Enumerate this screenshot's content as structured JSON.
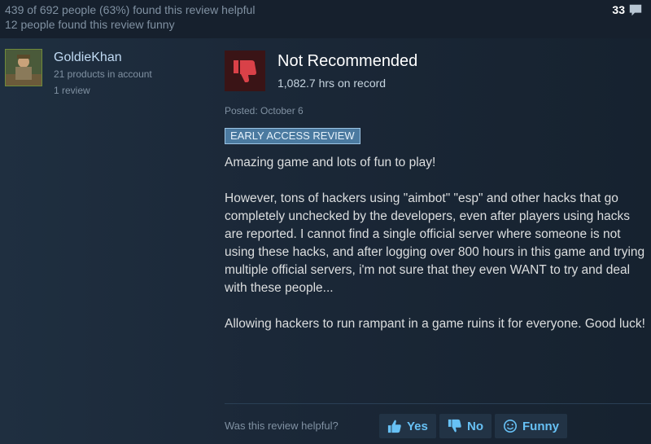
{
  "header": {
    "helpful_summary": "439 of 692 people (63%) found this review helpful",
    "funny_summary": "12 people found this review funny",
    "comment_count": "33",
    "comment_icon": "speech-bubble-icon"
  },
  "author": {
    "name": "GoldieKhan",
    "products": "21 products in account",
    "reviews": "1 review"
  },
  "review": {
    "recommendation": "Not Recommended",
    "recommendation_icon": "thumbs-down-icon",
    "hours": "1,082.7 hrs on record",
    "posted": "Posted: October 6",
    "badge": "EARLY ACCESS REVIEW",
    "paragraphs": [
      "Amazing game and lots of fun to play!",
      "However, tons of hackers using \"aimbot\" \"esp\" and other hacks that go completely unchecked by the developers, even after players using hacks are reported. I cannot find a single official server where someone is not using these hacks, and after logging over 800 hours in this game and trying multiple official servers, i'm not sure that they even WANT to try and deal with these people...",
      "Allowing hackers to run rampant in a game ruins it for everyone. Good luck!"
    ]
  },
  "feedback": {
    "question": "Was this review helpful?",
    "yes_label": "Yes",
    "no_label": "No",
    "funny_label": "Funny"
  },
  "colors": {
    "background": "#1b2838",
    "link_blue": "#67c1f5",
    "thumbs_down_red": "#d94148"
  }
}
